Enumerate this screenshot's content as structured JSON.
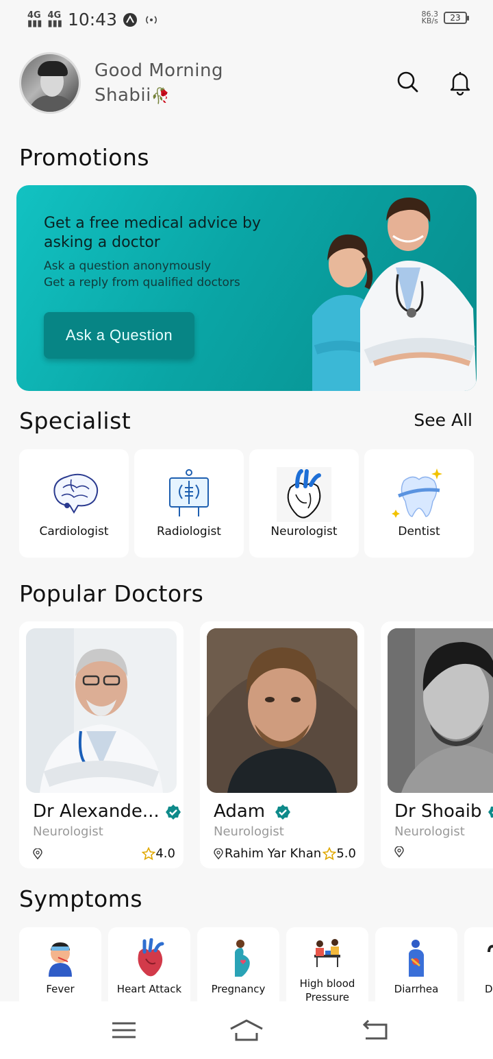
{
  "status_bar": {
    "signal1": "4G",
    "signal2": "4G",
    "time": "10:43",
    "speed_value": "86.3",
    "speed_unit": "KB/s",
    "battery": "23"
  },
  "header": {
    "greeting": "Good Morning",
    "username": "Shabii",
    "username_emoji": "🥀"
  },
  "promotions": {
    "title": "Promotions",
    "headline": "Get a free medical advice by asking a doctor",
    "line1": "Ask a question anonymously",
    "line2": "Get a reply from qualified doctors",
    "button": "Ask a Question"
  },
  "specialist": {
    "title": "Specialist",
    "see_all": "See All",
    "items": [
      {
        "label": "Cardiologist",
        "icon": "brain-icon"
      },
      {
        "label": "Radiologist",
        "icon": "xray-icon"
      },
      {
        "label": "Neurologist",
        "icon": "heart-icon"
      },
      {
        "label": "Dentist",
        "icon": "tooth-icon"
      }
    ]
  },
  "popular": {
    "title": "Popular Doctors",
    "doctors": [
      {
        "name": "Dr Alexande...",
        "specialty": "Neurologist",
        "location": "",
        "rating": "4.0"
      },
      {
        "name": "Adam",
        "specialty": "Neurologist",
        "location": "Rahim Yar Khan",
        "rating": "5.0"
      },
      {
        "name": "Dr Shoaib",
        "specialty": "Neurologist",
        "location": "",
        "rating": ""
      }
    ]
  },
  "symptoms": {
    "title": "Symptoms",
    "items": [
      {
        "label": "Fever"
      },
      {
        "label": "Heart Attack"
      },
      {
        "label": "Pregnancy"
      },
      {
        "label": "High blood Pressure"
      },
      {
        "label": "Diarrhea"
      },
      {
        "label": "D"
      }
    ]
  },
  "colors": {
    "accent": "#0aa5a5",
    "verified": "#0e8a8a",
    "star": "#e0a800"
  }
}
